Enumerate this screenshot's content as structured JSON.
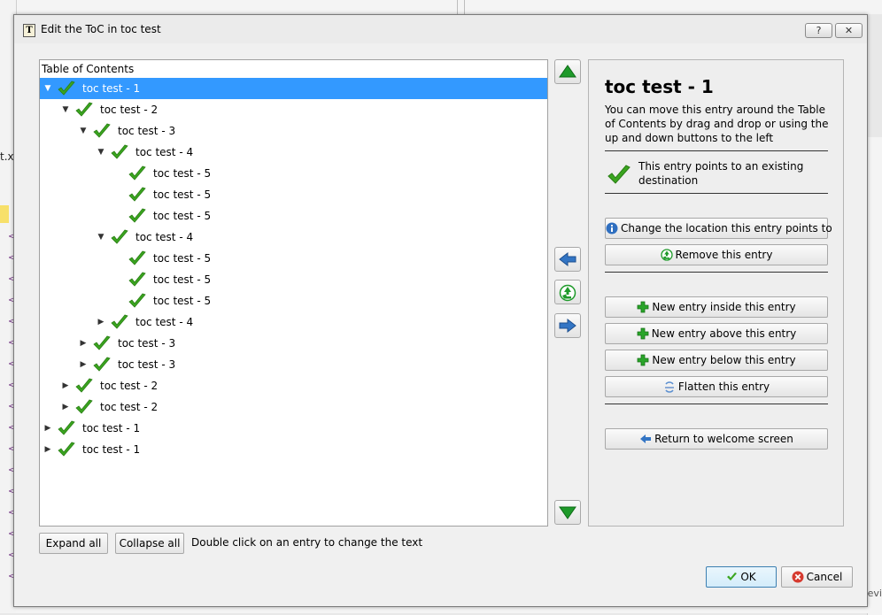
{
  "dialog": {
    "title": "Edit the ToC in toc test",
    "app_icon_letter": "T",
    "help_label": "?",
    "close_label": "✕"
  },
  "background": {
    "left_fragment": "t.xh",
    "right_fragment": "evi"
  },
  "tree": {
    "header": "Table of Contents",
    "rows": [
      {
        "label": "toc test - 1",
        "depth": 0,
        "state": "expanded",
        "selected": true
      },
      {
        "label": "toc test - 2",
        "depth": 1,
        "state": "expanded",
        "selected": false
      },
      {
        "label": "toc test - 3",
        "depth": 2,
        "state": "expanded",
        "selected": false
      },
      {
        "label": "toc test - 4",
        "depth": 3,
        "state": "expanded",
        "selected": false
      },
      {
        "label": "toc test - 5",
        "depth": 4,
        "state": "leaf",
        "selected": false
      },
      {
        "label": "toc test - 5",
        "depth": 4,
        "state": "leaf",
        "selected": false
      },
      {
        "label": "toc test - 5",
        "depth": 4,
        "state": "leaf",
        "selected": false
      },
      {
        "label": "toc test - 4",
        "depth": 3,
        "state": "expanded",
        "selected": false
      },
      {
        "label": "toc test - 5",
        "depth": 4,
        "state": "leaf",
        "selected": false
      },
      {
        "label": "toc test - 5",
        "depth": 4,
        "state": "leaf",
        "selected": false
      },
      {
        "label": "toc test - 5",
        "depth": 4,
        "state": "leaf",
        "selected": false
      },
      {
        "label": "toc test - 4",
        "depth": 3,
        "state": "collapsed",
        "selected": false
      },
      {
        "label": "toc test - 3",
        "depth": 2,
        "state": "collapsed",
        "selected": false
      },
      {
        "label": "toc test - 3",
        "depth": 2,
        "state": "collapsed",
        "selected": false
      },
      {
        "label": "toc test - 2",
        "depth": 1,
        "state": "collapsed",
        "selected": false
      },
      {
        "label": "toc test - 2",
        "depth": 1,
        "state": "collapsed",
        "selected": false
      },
      {
        "label": "toc test - 1",
        "depth": 0,
        "state": "collapsed",
        "selected": false
      },
      {
        "label": "toc test - 1",
        "depth": 0,
        "state": "collapsed",
        "selected": false
      }
    ]
  },
  "side_buttons": {
    "move_up_icon": "green-up-arrow-icon",
    "indent_left_icon": "blue-left-arrow-icon",
    "delete_icon": "recycle-icon",
    "indent_right_icon": "blue-right-arrow-icon",
    "move_down_icon": "green-down-arrow-icon"
  },
  "info": {
    "title": "toc test - 1",
    "description": "You can move this entry around the Table of Contents by drag and drop or using the up and down buttons to the left",
    "destination_status": "This entry points to an existing destination",
    "buttons": {
      "change_location": "Change the location this entry points to",
      "remove": "Remove this entry",
      "new_inside": "New entry inside this entry",
      "new_above": "New entry above this entry",
      "new_below": "New entry below this entry",
      "flatten": "Flatten this entry",
      "return": "Return to welcome screen"
    }
  },
  "footer": {
    "expand_all": "Expand all",
    "collapse_all": "Collapse all",
    "hint": "Double click on an entry to change the text",
    "ok": "OK",
    "cancel": "Cancel"
  },
  "colors": {
    "selection": "#3399ff",
    "check_green": "#3aa51f",
    "arrow_green": "#1e9a2a",
    "arrow_blue": "#3375c4"
  }
}
